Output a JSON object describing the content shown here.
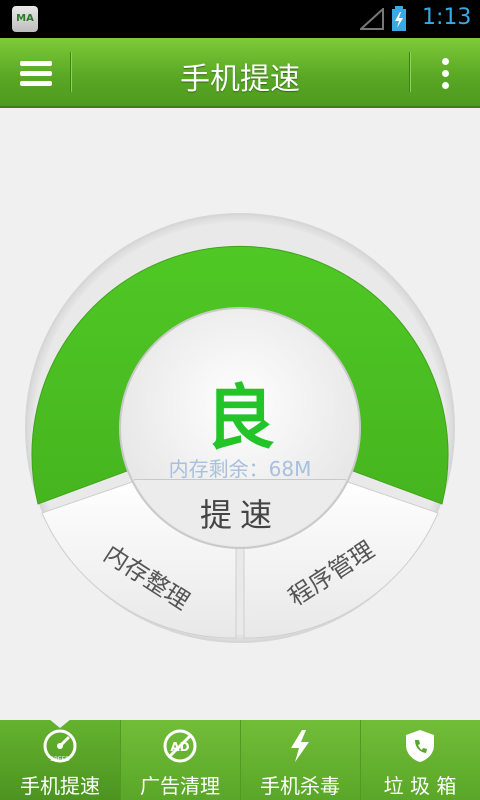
{
  "status_bar": {
    "app_icon_text": "MA",
    "time": "1:13",
    "battery_icon": "battery-charging-icon",
    "signal_icon": "signal-empty-icon"
  },
  "header": {
    "title": "手机提速",
    "menu_icon": "hamburger-menu-icon",
    "more_icon": "more-vertical-icon"
  },
  "gauge": {
    "rating": "良",
    "memory_label": "内存剩余：68M",
    "speed_button": "提速",
    "clean_memory_button": "内存整理",
    "program_manage_button": "程序管理",
    "accent_color": "#5ad12d"
  },
  "bottom_nav": {
    "items": [
      {
        "label": "手机提速",
        "icon": "speedometer-icon"
      },
      {
        "label": "广告清理",
        "icon": "ad-block-icon"
      },
      {
        "label": "手机杀毒",
        "icon": "lightning-icon"
      },
      {
        "label": "垃 圾 箱",
        "icon": "shield-phone-icon"
      }
    ],
    "active_index": 0
  }
}
